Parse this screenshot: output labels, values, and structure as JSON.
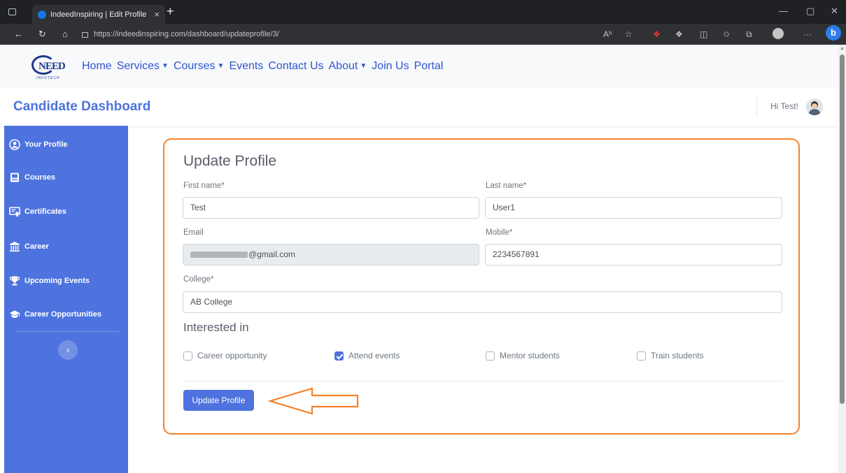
{
  "browser": {
    "tab_title": "IndeedInspiring | Edit Profile",
    "tab_close": "×",
    "new_tab": "+",
    "url": "https://indeedinspiring.com/dashboard/updateprofile/3/",
    "minimize": "—",
    "restore": "▢",
    "close": "✕",
    "back": "←",
    "refresh": "↻",
    "home": "⌂",
    "read_aloud": "Aʰ",
    "favorite": "☆",
    "extensions": "❖",
    "split": "◫",
    "favorites_bar": "✩",
    "collections": "⧉",
    "more": "···",
    "bing": "b"
  },
  "site": {
    "logo_text": "NEED",
    "logo_subtext": "INFOTECH",
    "nav": {
      "home": "Home",
      "services": "Services",
      "courses": "Courses",
      "events": "Events",
      "contact": "Contact Us",
      "about": "About",
      "join": "Join Us",
      "portal": "Portal",
      "caret": "▼"
    }
  },
  "header": {
    "title": "Candidate Dashboard",
    "greeting": "Hi Test!"
  },
  "sidebar": {
    "items": [
      {
        "label": "Your Profile",
        "icon": "user-circle-icon"
      },
      {
        "label": "Courses",
        "icon": "book-icon"
      },
      {
        "label": "Certificates",
        "icon": "certificate-icon"
      },
      {
        "label": "Career",
        "icon": "bank-icon"
      },
      {
        "label": "Upcoming Events",
        "icon": "trophy-icon"
      },
      {
        "label": "Career Opportunities",
        "icon": "graduation-cap-icon"
      }
    ],
    "collapse": "‹"
  },
  "form": {
    "title": "Update Profile",
    "first_name_label": "First name*",
    "first_name_value": "Test",
    "last_name_label": "Last name*",
    "last_name_value": "User1",
    "email_label": "Email",
    "email_value": "@gmail.com",
    "mobile_label": "Mobile*",
    "mobile_value": "2234567891",
    "college_label": "College*",
    "college_value": "AB College",
    "interested_title": "Interested in",
    "interests": [
      {
        "label": "Career opportunity",
        "checked": false
      },
      {
        "label": "Attend events",
        "checked": true
      },
      {
        "label": "Mentor students",
        "checked": false
      },
      {
        "label": "Train students",
        "checked": false
      }
    ],
    "submit_label": "Update Profile"
  },
  "colors": {
    "primary": "#4e73df",
    "annotation": "#f5822a",
    "chrome": "#202124"
  }
}
